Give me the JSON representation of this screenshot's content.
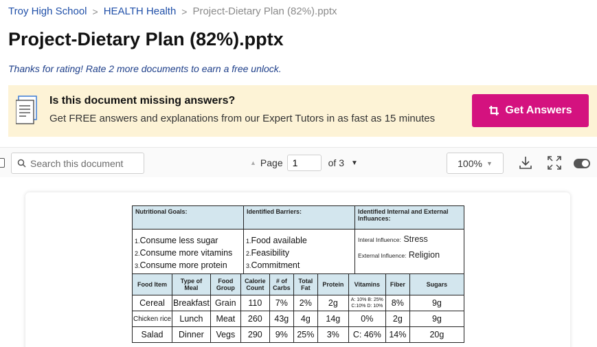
{
  "breadcrumb": {
    "school": "Troy High School",
    "course": "HEALTH Health",
    "current": "Project-Dietary Plan (82%).pptx",
    "separator": ">"
  },
  "title": "Project-Dietary Plan (82%).pptx",
  "rating_note": "Thanks for rating! Rate 2 more documents to earn a free unlock.",
  "banner": {
    "question": "Is this document missing answers?",
    "subtitle": "Get FREE answers and explanations from our Expert Tutors in as fast as 15 minutes",
    "button_label": "Get Answers"
  },
  "toolbar": {
    "search_placeholder": "Search this document",
    "page_label": "Page",
    "page_value": "1",
    "page_total": "of 3",
    "zoom": "100%"
  },
  "document": {
    "headers": {
      "goals": "Nutritional Goals:",
      "barriers": "Identified Barriers:",
      "influences": "Identified Internal and External Influances:"
    },
    "goals": [
      {
        "num": "1.",
        "text": "Consume less sugar"
      },
      {
        "num": "2.",
        "text": "Consume more vitamins"
      },
      {
        "num": "3.",
        "text": "Consume more protein"
      }
    ],
    "barriers": [
      {
        "num": "1.",
        "text": "Food available"
      },
      {
        "num": "2.",
        "text": "Feasibility"
      },
      {
        "num": "3.",
        "text": "Commitment"
      }
    ],
    "influences": {
      "internal_label": "Interal Influence:",
      "internal_value": "Stress",
      "external_label": "External Influence:",
      "external_value": "Religion"
    },
    "food_columns": [
      "Food Item",
      "Type of Meal",
      "Food Group",
      "Calorie Count",
      "# of Carbs",
      "Total Fat",
      "Protein",
      "Vitamins",
      "Fiber",
      "Sugars"
    ],
    "food_rows": [
      [
        "Cereal",
        "Breakfast",
        "Grain",
        "110",
        "7%",
        "2%",
        "2g",
        "A: 10% B: 25% C:10% D: 10%",
        "8%",
        "9g"
      ],
      [
        "Chicken rice",
        "Lunch",
        "Meat",
        "260",
        "43g",
        "4g",
        "14g",
        "0%",
        "2g",
        "9g"
      ],
      [
        "Salad",
        "Dinner",
        "Vegs",
        "290",
        "9%",
        "25%",
        "3%",
        "C: 46%",
        "14%",
        "20g"
      ]
    ]
  },
  "colors": {
    "brand_pink": "#d4127f",
    "banner_bg": "#fdf3d6",
    "link_blue": "#1f4fa8",
    "table_header_bg": "#d3e6ee"
  },
  "icons": [
    "document-icon",
    "crop-icon",
    "search-icon",
    "download-icon",
    "fullscreen-icon",
    "toggle-switch"
  ]
}
